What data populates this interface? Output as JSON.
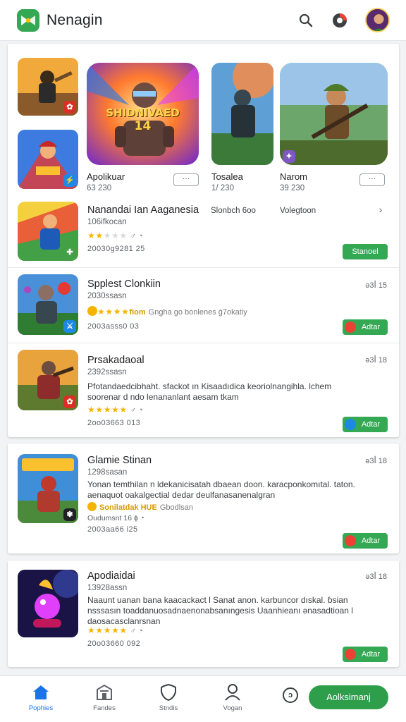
{
  "header": {
    "title": "Nenagin",
    "icons": [
      "search-icon",
      "record-icon",
      "avatar"
    ]
  },
  "featured": {
    "tiles": [
      {
        "title": "Apolikuar",
        "meta": "63 230",
        "more_label": "···"
      },
      {
        "title": "Tosalea",
        "meta": "1/ 230",
        "more_label": ""
      },
      {
        "title": "Narom",
        "meta": "39 230",
        "more_label": "···"
      }
    ],
    "poster_text_line1": "SHIDNIVAED",
    "poster_text_line2": "14"
  },
  "list": [
    {
      "title": "Nanandai  Ian Aaganesia",
      "sub": "106ifkocan",
      "col2": "Slonbch 6oo",
      "col3": "Volegtoon",
      "date": "20030g9281 25",
      "button": "Stanoel",
      "rating_meta": "♂ ◔"
    },
    {
      "title": "Spplest Clonkiin",
      "sub": "2030ssasn",
      "size": "ǝ3ꟾ 15",
      "rating_note": "Gngha go bonlenes ǵ7okatiy",
      "date": "2003asss0 03",
      "button": "Adtar",
      "stars_extra": "fiom"
    },
    {
      "title": "Prsakadaoal",
      "sub": "2392ssasn",
      "size": "ǝ3ꟾ 18",
      "desc": "Pfotandaedcibhaht. sfackot ın Kisaadıdica  keoriolnangihla. lchem soorenar d ndo lenananlant aesam tkam",
      "date": "2oo03663 013",
      "button": "Adtar"
    },
    {
      "title": "Glamie Stinan",
      "sub": "1298sasan",
      "size": "ǝ3ꟾ 18",
      "desc": "Yonan temthilan n  ldekanicisatah dbaean doon. karacponkomıtal. taton. aenaquot oakalgectial dedar deulfanasanenalgran",
      "rating_note": "Gbodlsan",
      "stars_extra": "Sonilatdak HUE",
      "extra_line": "Oudumsnt 16  ɸ  ◔",
      "date": "2003aa66 i25",
      "button": "Adtar"
    },
    {
      "title": "Apodiaidai",
      "sub": "13928assn",
      "size": "ǝ3ꟾ 18",
      "desc": "Naaunt uanan  bana kaacackact l Sanat anon. karbuncor dıskal. ɓsian nsssasın toaddanuosadnaenonabsanıngesis Uaanhieanı ǝnasadtioan l daosacasclanrsnan",
      "date": "20o03660 092",
      "button": "Adtar"
    }
  ],
  "bottom_nav": {
    "items": [
      {
        "label": "Pophies",
        "icon": "home-icon",
        "active": true
      },
      {
        "label": "Fandes",
        "icon": "store-icon",
        "active": false
      },
      {
        "label": "Stndis",
        "icon": "shield-icon",
        "active": false
      },
      {
        "label": "Vogan",
        "icon": "person-icon",
        "active": false
      }
    ],
    "side_icon_label": "ↄ",
    "cta_label": "Aolksimanj"
  },
  "colors": {
    "accent_green": "#34a853",
    "accent_blue": "#1a73e8",
    "star": "#f4b400"
  }
}
